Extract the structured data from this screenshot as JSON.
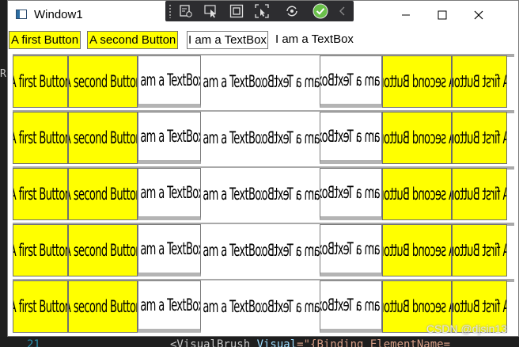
{
  "window": {
    "title": "Window1",
    "minimize_label": "",
    "maximize_label": "",
    "close_label": ""
  },
  "debug_toolbar": {
    "icons": [
      "live-visual-tree-icon",
      "select-element-icon",
      "display-layout-adorners-icon",
      "track-focus-icon",
      "hot-reload-icon",
      "check-icon",
      "collapse-icon"
    ]
  },
  "top_row": {
    "button1": "A first Button",
    "button2": "A second Button",
    "textbox": "I am a TextBox",
    "label": "I am a TextBox"
  },
  "brush_cells": {
    "button1": "A first Button",
    "button2": "A second Button",
    "textbox": "I am a TextBox",
    "label": "I am a TextBox"
  },
  "editor": {
    "line_number": "21",
    "code_prefix": "<VisualBrush ",
    "code_attr": "Visual",
    "code_rest": "=\"{Binding ElementName="
  },
  "watermark": "CSDN @djsin13",
  "colors": {
    "button_bg": "#ffff00",
    "window_bg": "#ffffff",
    "toolbar_bg": "#2d2d30",
    "check_green": "#6ac04a"
  }
}
